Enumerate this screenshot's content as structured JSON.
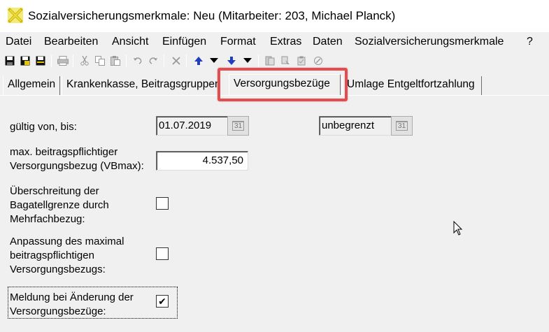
{
  "window": {
    "title": "Sozialversicherungsmerkmale: Neu (Mitarbeiter: 203, Michael Planck)",
    "icon": "x-logo-icon"
  },
  "menu": {
    "items": [
      "Datei",
      "Bearbeiten",
      "Ansicht",
      "Einfügen",
      "Format",
      "Extras",
      "Daten",
      "Sozialversicherungsmerkmale",
      "?"
    ]
  },
  "toolbar": {
    "icons": [
      "save-icon",
      "save-as-icon",
      "save-all-icon",
      "print-icon",
      "cut-icon",
      "copy-icon",
      "paste-icon",
      "undo-icon",
      "redo-icon",
      "delete-icon",
      "move-up-icon",
      "dropdown-icon",
      "move-down-icon",
      "dropdown-icon",
      "doc1-icon",
      "doc2-icon",
      "clipboard-icon",
      "tools-icon"
    ]
  },
  "tabs": {
    "items": [
      "Allgemein",
      "Krankenkasse, Beitragsgruppen",
      "Versorgungsbezüge",
      "Umlage Entgeltfortzahlung"
    ],
    "active": "Versorgungsbezüge"
  },
  "form": {
    "valid_label": "gültig von, bis:",
    "valid_from": "01.07.2019",
    "valid_to": "unbegrenzt",
    "calendar_glyph": "31",
    "vbmax_label_line1": "max. beitragspflichtiger",
    "vbmax_label_line2": "Versorgungsbezug (VBmax):",
    "vbmax_value": "4.537,50",
    "bagatell_line1": "Überschreitung der",
    "bagatell_line2": "Bagatellgrenze durch",
    "bagatell_line3": "Mehrfachbezug:",
    "bagatell_checked": false,
    "anpassung_line1": "Anpassung des maximal",
    "anpassung_line2": "beitragspflichtigen",
    "anpassung_line3": "Versorgungsbezugs:",
    "anpassung_checked": false,
    "meldung_line1": "Meldung bei Änderung der",
    "meldung_line2": "Versorgungsbezüge:",
    "meldung_checked": true,
    "check_glyph": "✔"
  },
  "colors": {
    "highlight": "#e84b4b",
    "icon_blue": "#1f3fbf",
    "logo_yellow": "#e8d52a"
  }
}
